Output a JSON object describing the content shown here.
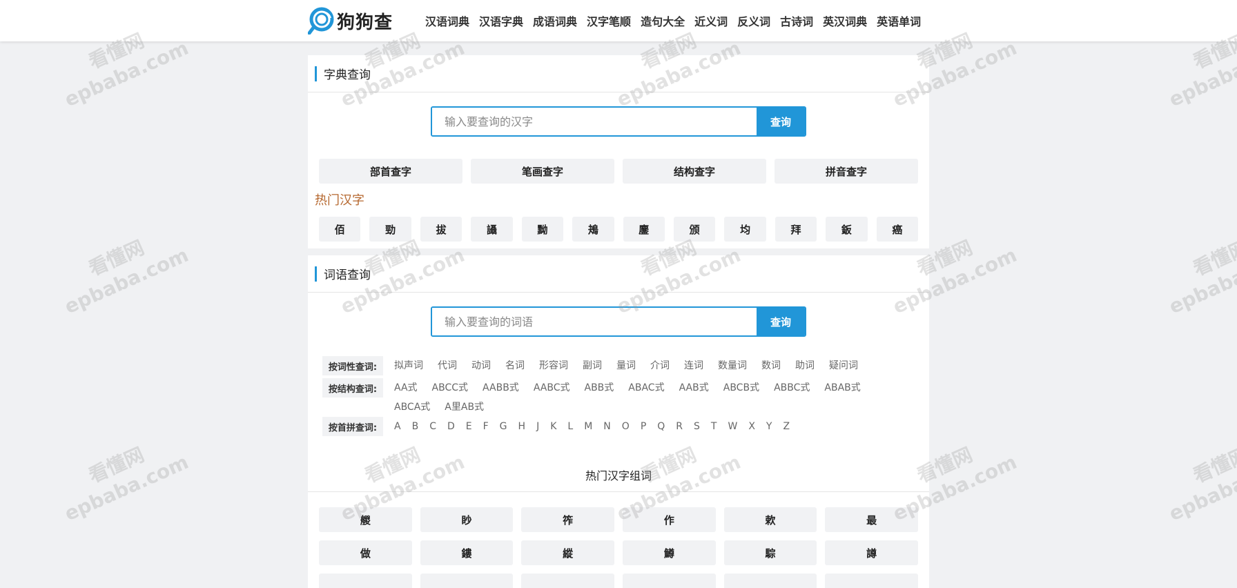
{
  "brand": {
    "name": "狗狗查"
  },
  "nav": [
    "汉语词典",
    "汉语字典",
    "成语词典",
    "汉字笔顺",
    "造句大全",
    "近义词",
    "反义词",
    "古诗词",
    "英汉词典",
    "英语单词"
  ],
  "dict_panel": {
    "title": "字典查询",
    "search_placeholder": "输入要查询的汉字",
    "search_button": "查询",
    "quick_links": [
      "部首查字",
      "笔画查字",
      "结构查字",
      "拼音查字"
    ],
    "hot_title": "热门汉字",
    "hot_chars": [
      "佰",
      "勁",
      "拔",
      "讘",
      "黝",
      "鴂",
      "鏖",
      "颁",
      "均",
      "拜",
      "鈑",
      "癌"
    ]
  },
  "word_panel": {
    "title": "词语查询",
    "search_placeholder": "输入要查询的词语",
    "search_button": "查询",
    "filters": [
      {
        "label": "按词性查词:",
        "items": [
          "拟声词",
          "代词",
          "动词",
          "名词",
          "形容词",
          "副词",
          "量词",
          "介词",
          "连词",
          "数量词",
          "数词",
          "助词",
          "疑问词"
        ]
      },
      {
        "label": "按结构查词:",
        "items": [
          "AA式",
          "ABCC式",
          "AABB式",
          "AABC式",
          "ABB式",
          "ABAC式",
          "AAB式",
          "ABCB式",
          "ABBC式",
          "ABAB式",
          "ABCA式",
          "A里AB式"
        ]
      },
      {
        "label": "按首拼查词:",
        "items": [
          "A",
          "B",
          "C",
          "D",
          "E",
          "F",
          "G",
          "H",
          "J",
          "K",
          "L",
          "M",
          "N",
          "O",
          "P",
          "Q",
          "R",
          "S",
          "T",
          "W",
          "X",
          "Y",
          "Z"
        ]
      }
    ],
    "combo_title": "热门汉字组词",
    "combo_chars": [
      "艐",
      "眇",
      "筰",
      "作",
      "欶",
      "最",
      "做",
      "鏤",
      "縱",
      "鱒",
      "騌",
      "譐"
    ]
  },
  "watermark": {
    "line1": "看懂网",
    "line2": "epbaba.com"
  }
}
